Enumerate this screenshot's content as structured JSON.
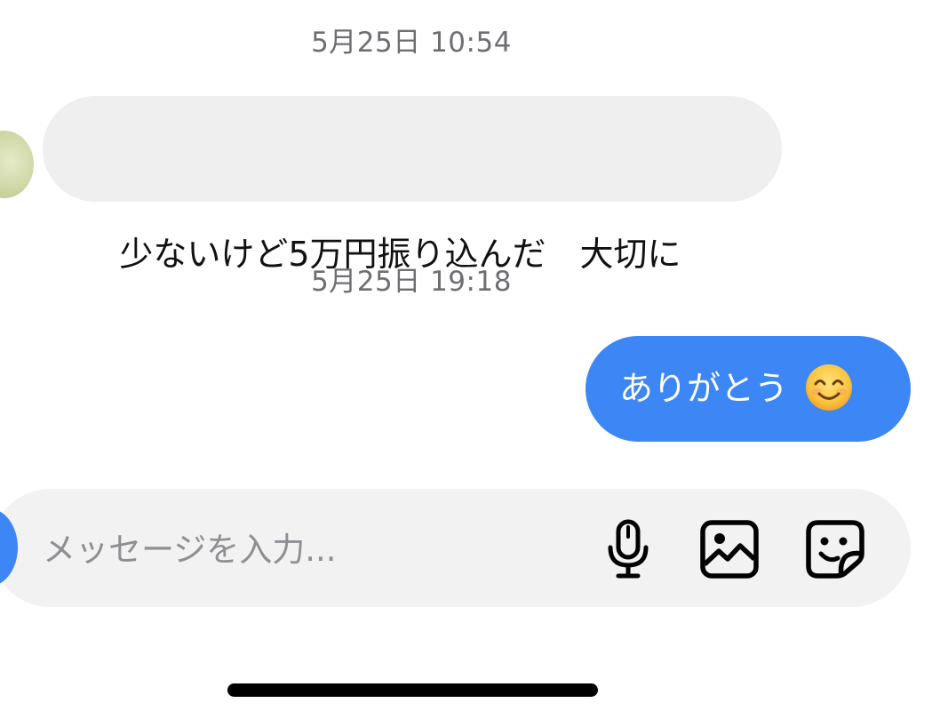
{
  "conversation": {
    "messages": [
      {
        "timestamp": "5月25日 10:54",
        "direction": "incoming",
        "text": "少ないけど5万円振り込んだ　大切に"
      },
      {
        "timestamp": "5月25日 19:18",
        "direction": "outgoing",
        "text": "ありがとう",
        "emoji": "smiling-face-icon"
      }
    ]
  },
  "composer": {
    "placeholder": "メッセージを入力...",
    "value": "",
    "icons": [
      "microphone-icon",
      "image-icon",
      "sticker-icon"
    ]
  },
  "colors": {
    "outgoing_bubble": "#3d86f5",
    "incoming_bubble": "#efefef",
    "timestamp_text": "#6e6e73",
    "composer_bg": "#f2f2f3"
  }
}
